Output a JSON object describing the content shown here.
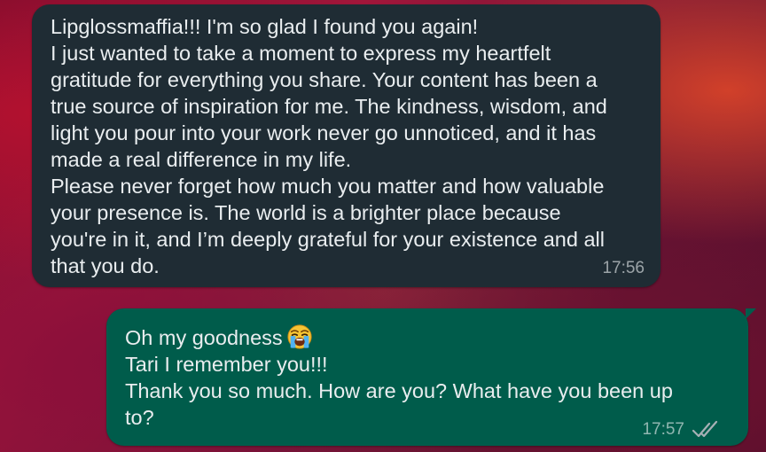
{
  "colors": {
    "incoming_bubble": "#1f2c34",
    "outgoing_bubble": "#005c4b",
    "text": "#e9edef",
    "meta_text": "#a7b0b5"
  },
  "messages": [
    {
      "direction": "incoming",
      "lines": [
        "Lipglossmaffia!!! I'm so glad I found you again!",
        "I just wanted to take a moment to express my heartfelt",
        "gratitude for everything you share. Your content has been a",
        "true source of inspiration for me. The kindness, wisdom, and",
        "light you pour into your work never go unnoticed, and it has",
        "made a real difference in my life.",
        "Please never forget how much you matter and how valuable",
        "your presence is. The world is a brighter place because",
        "you're in it, and I’m deeply grateful for your existence and all",
        "that you do."
      ],
      "time": "17:56"
    },
    {
      "direction": "outgoing",
      "lines": [
        "Oh my goodness",
        "Tari I remember you!!!",
        "Thank you so much. How are you? What have you been up",
        "to?"
      ],
      "emoji": "loudly-crying-face",
      "time": "17:57",
      "status_icon": "double-check-icon"
    }
  ]
}
